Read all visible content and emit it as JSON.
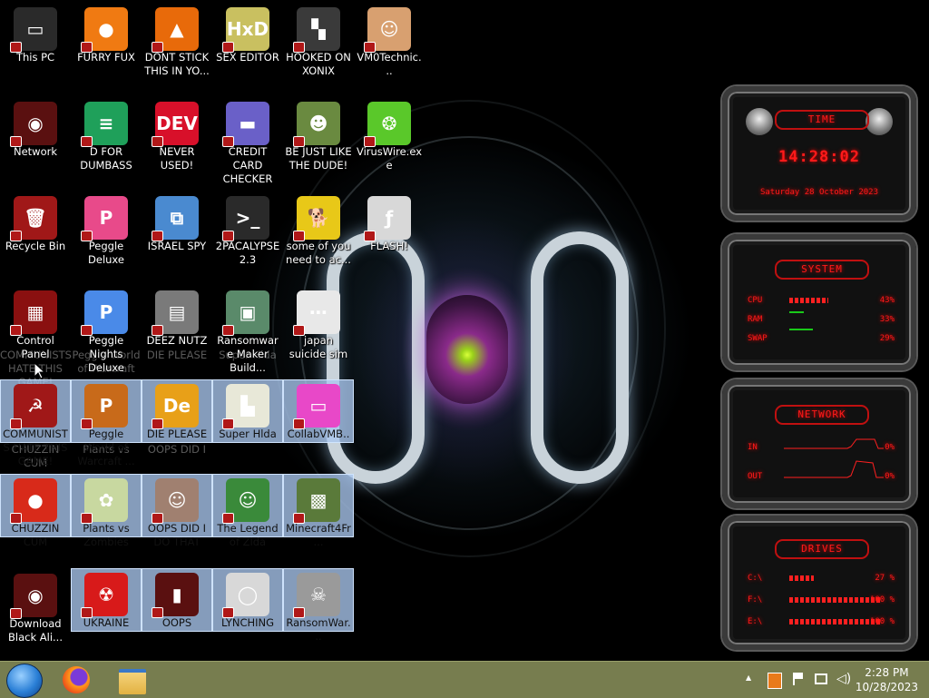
{
  "desktop": {
    "icons": [
      {
        "label": "This PC",
        "color": "#2a2a2a",
        "glyph": "▭"
      },
      {
        "label": "FURRY FUX",
        "color": "#f07a12",
        "glyph": "●"
      },
      {
        "label": "DONT STICK THIS IN YO...",
        "color": "#e86a0a",
        "glyph": "▲"
      },
      {
        "label": "SEX EDITOR",
        "color": "#c9c060",
        "glyph": "HxD"
      },
      {
        "label": "HOOKED ON XONIX",
        "color": "#3a3a3a",
        "glyph": "▚"
      },
      {
        "label": "VM0Technic...",
        "color": "#d8a070",
        "glyph": "☺"
      },
      {
        "label": "Network",
        "color": "#5a1010",
        "glyph": "◉"
      },
      {
        "label": "D FOR DUMBASS",
        "color": "#1fa05a",
        "glyph": "≡"
      },
      {
        "label": "NEVER USED!",
        "color": "#d8102a",
        "glyph": "DEV"
      },
      {
        "label": "CREDIT CARD CHECKER",
        "color": "#6a60c8",
        "glyph": "▬"
      },
      {
        "label": "BE JUST LIKE THE DUDE!",
        "color": "#6a8a40",
        "glyph": "☻"
      },
      {
        "label": "VirusWire.exe",
        "color": "#5ac82a",
        "glyph": "❂"
      },
      {
        "label": "Recycle Bin",
        "color": "#a01818",
        "glyph": "🗑"
      },
      {
        "label": "Peggle Deluxe",
        "color": "#e84a8a",
        "glyph": "P"
      },
      {
        "label": "ISRAEL SPY",
        "color": "#4a8ad0",
        "glyph": "⧉"
      },
      {
        "label": "2PACALYPSE 2.3",
        "color": "#2a2a2a",
        "glyph": ">_"
      },
      {
        "label": "some of you need to ac...",
        "color": "#e8c818",
        "glyph": "🐕"
      },
      {
        "label": "FLASH!",
        "color": "#d8d8d8",
        "glyph": "ƒ"
      },
      {
        "label": "Control Panel",
        "color": "#8a1010",
        "glyph": "▦"
      },
      {
        "label": "Peggle Nights Deluxe",
        "color": "#4a8ae8",
        "glyph": "P"
      },
      {
        "label": "DEEZ NUTZ",
        "color": "#7a7a7a",
        "glyph": "▤"
      },
      {
        "label": "Ransomware Maker Build...",
        "color": "#5a8a6a",
        "glyph": "▣"
      },
      {
        "label": "japan suicide sim",
        "color": "#e8e8e8",
        "glyph": "⋯"
      },
      {
        "label": "Download Black Ali...",
        "color": "#5a1010",
        "glyph": "◉"
      }
    ],
    "selected_icons": [
      {
        "label": "COMMUNISTS HATE THIS GAME!",
        "color": "#a01818",
        "glyph": "☭"
      },
      {
        "label": "Peggle World of Warcraft ...",
        "color": "#c86a1a",
        "glyph": "P"
      },
      {
        "label": "DIE PLEASE",
        "color": "#e8a018",
        "glyph": "De"
      },
      {
        "label": "Super Hlda",
        "color": "#e8e8d8",
        "glyph": "▙"
      },
      {
        "label": "CollabVMB...",
        "color": "#e848c8",
        "glyph": "▭"
      },
      {
        "label": "CHUZZIN CUM",
        "color": "#d82a1a",
        "glyph": "●"
      },
      {
        "label": "Plants vs Zombies",
        "color": "#c8d8a0",
        "glyph": "✿"
      },
      {
        "label": "OOPS DID I DO THAT",
        "color": "#a08070",
        "glyph": "☺"
      },
      {
        "label": "The Legend of Zlda",
        "color": "#3a8a3a",
        "glyph": "☺"
      },
      {
        "label": "Minecraft4Fr...",
        "color": "#5a7a3a",
        "glyph": "▩"
      },
      {
        "label": "UKRAINE",
        "color": "#d81a1a",
        "glyph": "☢"
      },
      {
        "label": "OOPS",
        "color": "#5a1010",
        "glyph": "▮"
      },
      {
        "label": "LYNCHING",
        "color": "#d8d8d8",
        "glyph": "◯"
      },
      {
        "label": "RansomWar...",
        "color": "#9a9a9a",
        "glyph": "☠"
      }
    ],
    "ghost_labels": [
      {
        "text": "COMMUNISTS HATE THIS GAME!"
      },
      {
        "text": "Peggle World of Warcraft"
      },
      {
        "text": "DIE PLEASE"
      },
      {
        "text": "Super Hlda"
      },
      {
        "text": "CHUZZIN CUM"
      },
      {
        "text": "Plants vs"
      },
      {
        "text": "OOPS DID I"
      }
    ]
  },
  "gadgets": {
    "time": {
      "title": "TIME",
      "clock": "14:28:02",
      "date": "Saturday 28 October 2023"
    },
    "system": {
      "title": "SYSTEM",
      "rows": [
        {
          "name": "CPU",
          "value": "43%",
          "level": 0.43
        },
        {
          "name": "RAM",
          "value": "33%",
          "level": 0.33
        },
        {
          "name": "SWAP",
          "value": "29%",
          "level": 0.29
        }
      ]
    },
    "network": {
      "title": "NETWORK",
      "rows": [
        {
          "name": "IN",
          "value": "0%"
        },
        {
          "name": "OUT",
          "value": "0%"
        }
      ]
    },
    "drives": {
      "title": "DRIVES",
      "rows": [
        {
          "name": "C:\\",
          "value": "27 %",
          "level": 0.27
        },
        {
          "name": "F:\\",
          "value": "100 %",
          "level": 1.0
        },
        {
          "name": "E:\\",
          "value": "100 %",
          "level": 1.0
        }
      ]
    }
  },
  "taskbar": {
    "time": "2:28 PM",
    "date": "10/28/2023",
    "tray_up": "▲"
  }
}
